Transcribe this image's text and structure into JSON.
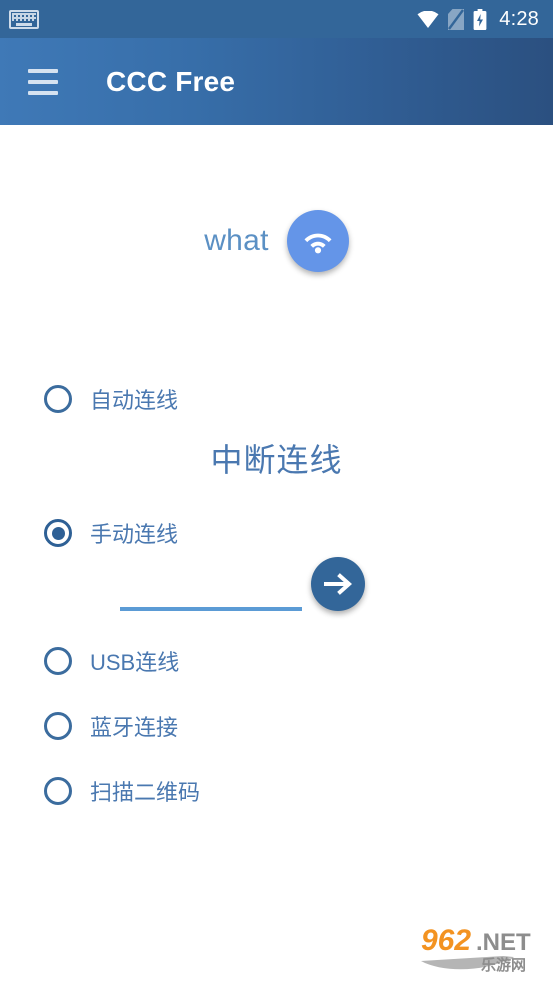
{
  "status_bar": {
    "time": "4:28",
    "icons": [
      "keyboard-icon",
      "wifi-icon",
      "sim-card-icon",
      "battery-charging-icon"
    ],
    "background_color": "#336699"
  },
  "app_bar": {
    "title": "CCC Free",
    "menu_icon": "hamburger-menu-icon",
    "gradient_from": "#3f79b7",
    "gradient_to": "#2b5080"
  },
  "main": {
    "network": {
      "name": "what",
      "icon": "wifi-icon",
      "fab_color": "#6495e8",
      "text_color": "#5b90c4"
    },
    "disconnect_label": "中断连线",
    "connection_options": [
      {
        "label": "自动连线",
        "selected": false
      },
      {
        "label": "手动连线",
        "selected": true
      },
      {
        "label": "USB连线",
        "selected": false
      },
      {
        "label": "蓝牙连接",
        "selected": false
      },
      {
        "label": "扫描二维码",
        "selected": false
      }
    ],
    "manual_input": {
      "value": "",
      "placeholder": "",
      "underline_color": "#5b9bd5"
    },
    "go_button": {
      "icon": "arrow-right-icon",
      "color": "#336699"
    }
  },
  "watermark": {
    "number": "962",
    "domain": ".NET",
    "subtitle": "乐游网",
    "number_color": "#f39321",
    "domain_color": "#8d8d8d"
  }
}
